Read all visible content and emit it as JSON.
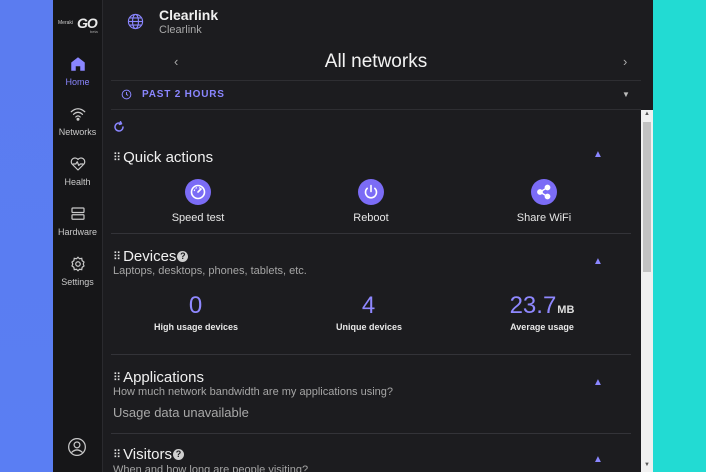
{
  "logo": {
    "brand_small": "Meraki",
    "brand_big": "GO",
    "tag": "beta"
  },
  "nav": [
    {
      "label": "Home",
      "icon": "home-icon",
      "active": true
    },
    {
      "label": "Networks",
      "icon": "wifi-icon",
      "active": false
    },
    {
      "label": "Health",
      "icon": "heart-pulse-icon",
      "active": false
    },
    {
      "label": "Hardware",
      "icon": "hardware-icon",
      "active": false
    },
    {
      "label": "Settings",
      "icon": "gear-icon",
      "active": false
    }
  ],
  "header": {
    "network_name": "Clearlink",
    "network_sub": "Clearlink"
  },
  "title_bar": {
    "title": "All networks",
    "prev": "‹",
    "next": "›"
  },
  "time_filter": {
    "label": "PAST 2 HOURS"
  },
  "quick_actions": {
    "title": "Quick actions",
    "items": [
      {
        "label": "Speed test",
        "icon": "speedometer-icon"
      },
      {
        "label": "Reboot",
        "icon": "power-icon"
      },
      {
        "label": "Share WiFi",
        "icon": "share-icon"
      }
    ]
  },
  "devices": {
    "title": "Devices",
    "subtitle": "Laptops, desktops, phones, tablets, etc.",
    "stats": [
      {
        "value": "0",
        "unit": "",
        "caption": "High usage devices"
      },
      {
        "value": "4",
        "unit": "",
        "caption": "Unique devices"
      },
      {
        "value": "23.7",
        "unit": "MB",
        "caption": "Average usage"
      }
    ]
  },
  "applications": {
    "title": "Applications",
    "subtitle": "How much network bandwidth are my applications using?",
    "status": "Usage data unavailable"
  },
  "visitors": {
    "title": "Visitors",
    "subtitle": "When and how long are people visiting?"
  },
  "colors": {
    "accent": "#8a86ff",
    "icon_fill": "#7b6cf6",
    "panel": "#1c1c1f",
    "left_bg": "#5b7cf0",
    "right_bg": "#22dbd3"
  }
}
